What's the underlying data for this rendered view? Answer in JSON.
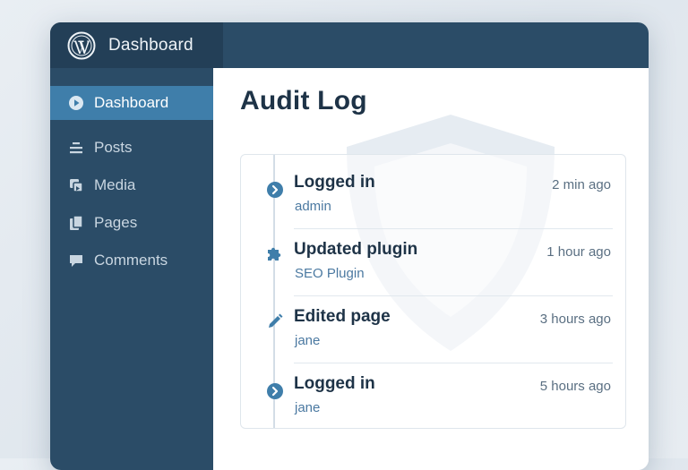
{
  "header": {
    "title": "Dashboard",
    "logo_icon": "wordpress-logo-icon"
  },
  "sidebar": {
    "items": [
      {
        "label": "Dashboard",
        "icon": "dashboard-icon",
        "active": true
      },
      {
        "label": "Posts",
        "icon": "posts-icon",
        "active": false
      },
      {
        "label": "Media",
        "icon": "media-icon",
        "active": false
      },
      {
        "label": "Pages",
        "icon": "pages-icon",
        "active": false
      },
      {
        "label": "Comments",
        "icon": "comments-icon",
        "active": false
      }
    ]
  },
  "main": {
    "title": "Audit Log",
    "watermark_icon": "shield-icon",
    "entries": [
      {
        "action": "Logged in",
        "user": "admin",
        "time": "2 min ago",
        "icon": "chevron-right-icon"
      },
      {
        "action": "Updated plugin",
        "user": "SEO Plugin",
        "time": "1 hour ago",
        "icon": "puzzle-icon"
      },
      {
        "action": "Edited page",
        "user": "jane",
        "time": "3 hours ago",
        "icon": "pencil-icon"
      },
      {
        "action": "Logged in",
        "user": "jane",
        "time": "5 hours ago",
        "icon": "chevron-right-icon"
      }
    ]
  },
  "colors": {
    "topbar": "#2b4c67",
    "brand": "#233f57",
    "sidebar": "#2b4c67",
    "active_item": "#3f7eaa",
    "accent": "#3f7eaa",
    "title_text": "#1e3347"
  }
}
